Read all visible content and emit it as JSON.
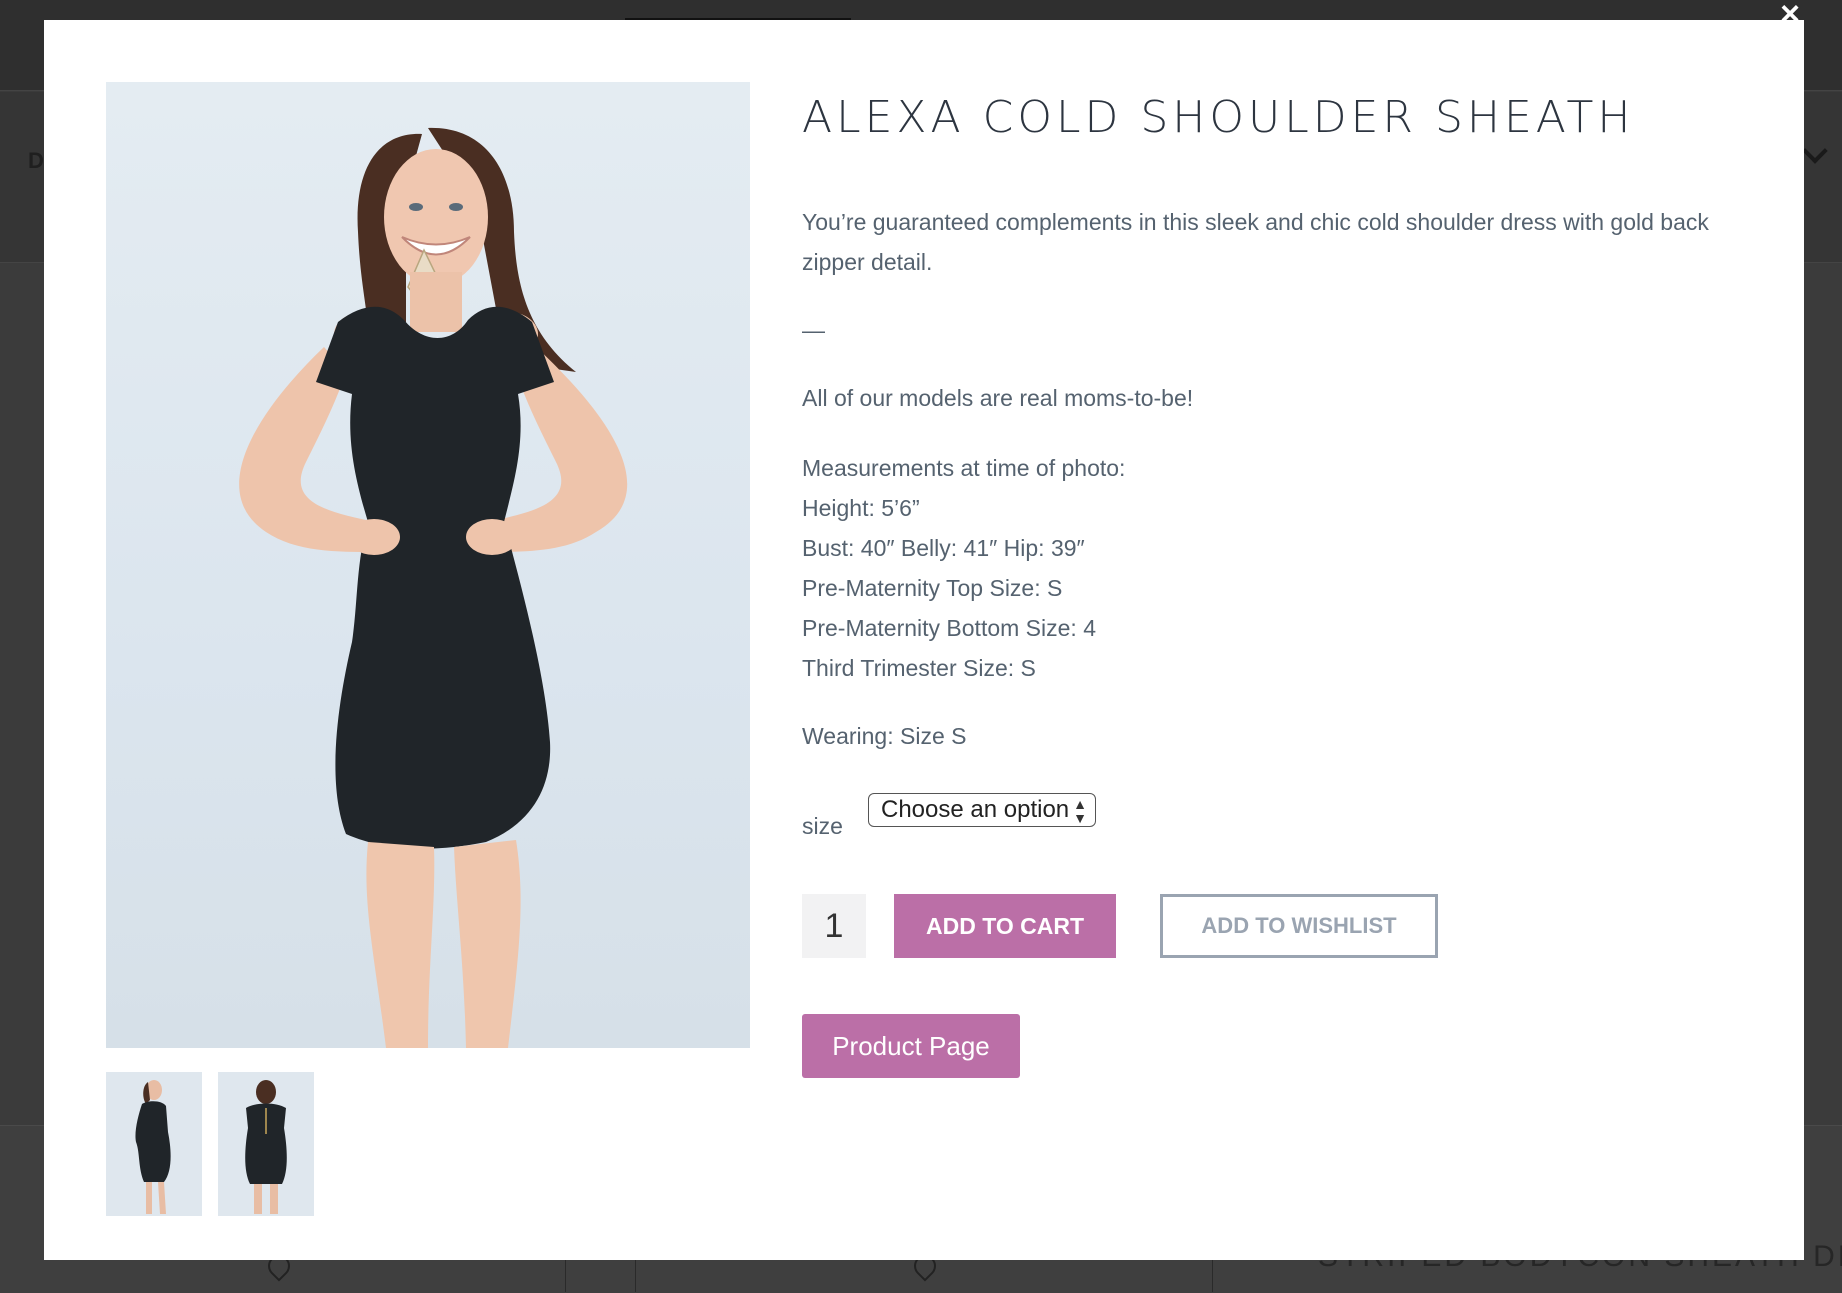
{
  "background": {
    "nav_letter": "D",
    "bottom_title": "STRIPED BODYCON SHEATH DRESS"
  },
  "modal": {
    "close_icon": "×",
    "product": {
      "title": "ALEXA COLD SHOULDER SHEATH",
      "description": "You’re guaranteed complements in this sleek and chic cold shoulder dress with gold back zipper detail.",
      "dash": "—",
      "models_note": "All of our models are real moms-to-be!",
      "measurements": [
        "Measurements at time of photo:",
        "Height: 5’6”",
        "Bust: 40″ Belly: 41″ Hip: 39″",
        "Pre-Maternity Top Size: S",
        "Pre-Maternity Bottom Size: 4",
        "Third Trimester Size: S"
      ],
      "wearing": "Wearing: Size S"
    },
    "size": {
      "label": "size",
      "selected": "Choose an option"
    },
    "quantity": "1",
    "add_to_cart": "ADD TO CART",
    "add_to_wishlist": "ADD TO WISHLIST",
    "product_page": "Product Page",
    "colors": {
      "accent": "#bb6fa7",
      "title_text": "#2d3540",
      "body_text": "#55626f",
      "wishlist_border": "#9aa4b1"
    },
    "icons": {
      "close": "close-icon",
      "select_arrows": "select-arrows-icon"
    }
  }
}
